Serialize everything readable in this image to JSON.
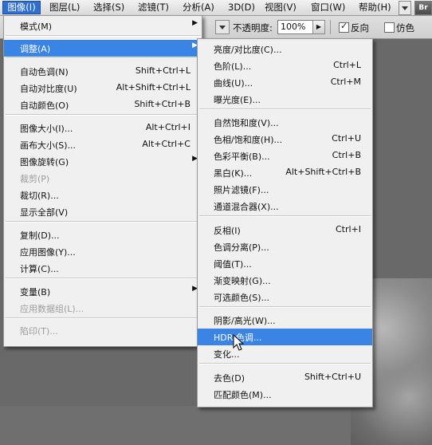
{
  "menubar": {
    "items": [
      "图像(I)",
      "图层(L)",
      "选择(S)",
      "滤镜(T)",
      "分析(A)",
      "3D(D)",
      "视图(V)",
      "窗口(W)",
      "帮助(H)"
    ],
    "right_badge": "Br"
  },
  "optionsbar": {
    "opacity_label": "不透明度:",
    "opacity_value": "100%",
    "reverse_label": "反向",
    "dither_label": "仿色",
    "reverse_checked": true,
    "dither_checked": false
  },
  "image_menu": {
    "items": [
      {
        "label": "模式(M)",
        "shortcut": "",
        "submenu": true
      },
      {
        "separator": true
      },
      {
        "label": "调整(A)",
        "shortcut": "",
        "submenu": true,
        "highlighted": true
      },
      {
        "separator": true
      },
      {
        "label": "自动色调(N)",
        "shortcut": "Shift+Ctrl+L"
      },
      {
        "label": "自动对比度(U)",
        "shortcut": "Alt+Shift+Ctrl+L"
      },
      {
        "label": "自动颜色(O)",
        "shortcut": "Shift+Ctrl+B"
      },
      {
        "separator": true
      },
      {
        "label": "图像大小(I)...",
        "shortcut": "Alt+Ctrl+I"
      },
      {
        "label": "画布大小(S)...",
        "shortcut": "Alt+Ctrl+C"
      },
      {
        "label": "图像旋转(G)",
        "shortcut": "",
        "submenu": true
      },
      {
        "label": "裁剪(P)",
        "shortcut": "",
        "disabled": true
      },
      {
        "label": "裁切(R)...",
        "shortcut": ""
      },
      {
        "label": "显示全部(V)",
        "shortcut": ""
      },
      {
        "separator": true
      },
      {
        "label": "复制(D)...",
        "shortcut": ""
      },
      {
        "label": "应用图像(Y)...",
        "shortcut": ""
      },
      {
        "label": "计算(C)...",
        "shortcut": ""
      },
      {
        "separator": true
      },
      {
        "label": "变量(B)",
        "shortcut": "",
        "submenu": true
      },
      {
        "label": "应用数据组(L)...",
        "shortcut": "",
        "disabled": true
      },
      {
        "separator": true
      },
      {
        "label": "陷印(T)...",
        "shortcut": "",
        "disabled": true
      }
    ]
  },
  "adjust_menu": {
    "items": [
      {
        "label": "亮度/对比度(C)...",
        "shortcut": ""
      },
      {
        "label": "色阶(L)...",
        "shortcut": "Ctrl+L"
      },
      {
        "label": "曲线(U)...",
        "shortcut": "Ctrl+M"
      },
      {
        "label": "曝光度(E)...",
        "shortcut": ""
      },
      {
        "separator": true
      },
      {
        "label": "自然饱和度(V)...",
        "shortcut": ""
      },
      {
        "label": "色相/饱和度(H)...",
        "shortcut": "Ctrl+U"
      },
      {
        "label": "色彩平衡(B)...",
        "shortcut": "Ctrl+B"
      },
      {
        "label": "黑白(K)...",
        "shortcut": "Alt+Shift+Ctrl+B"
      },
      {
        "label": "照片滤镜(F)...",
        "shortcut": ""
      },
      {
        "label": "通道混合器(X)...",
        "shortcut": ""
      },
      {
        "separator": true
      },
      {
        "label": "反相(I)",
        "shortcut": "Ctrl+I"
      },
      {
        "label": "色调分离(P)...",
        "shortcut": ""
      },
      {
        "label": "阈值(T)...",
        "shortcut": ""
      },
      {
        "label": "渐变映射(G)...",
        "shortcut": ""
      },
      {
        "label": "可选颜色(S)...",
        "shortcut": ""
      },
      {
        "separator": true
      },
      {
        "label": "阴影/高光(W)...",
        "shortcut": ""
      },
      {
        "label": "HDR 色调...",
        "shortcut": "",
        "highlighted": true
      },
      {
        "label": "变化...",
        "shortcut": ""
      },
      {
        "separator": true
      },
      {
        "label": "去色(D)",
        "shortcut": "Shift+Ctrl+U"
      },
      {
        "label": "匹配颜色(M)...",
        "shortcut": ""
      }
    ]
  },
  "colors": {
    "highlight": "#3a84e6",
    "menubar_active": "#2f6fd0"
  }
}
